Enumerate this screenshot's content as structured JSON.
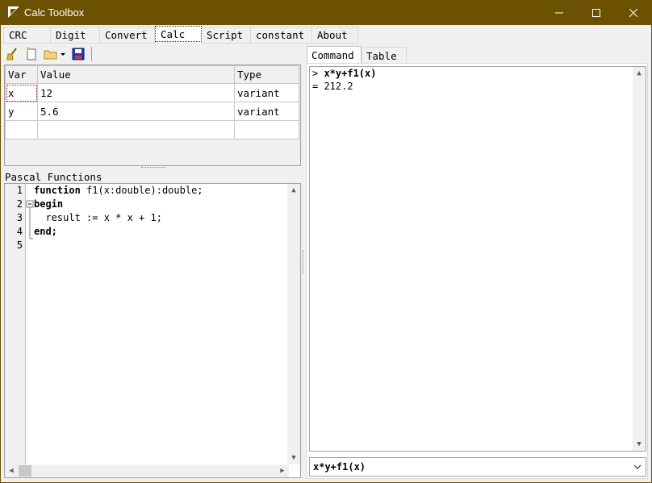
{
  "window": {
    "title": "Calc Toolbox"
  },
  "tabs": [
    "CRC",
    "Digit",
    "Convert",
    "Calc",
    "Script",
    "constant",
    "About"
  ],
  "active_tab": "Calc",
  "toolbar": {
    "icons": [
      "clear-icon",
      "new-file-icon",
      "open-folder-icon",
      "save-icon"
    ]
  },
  "variables": {
    "headers": {
      "var": "Var",
      "value": "Value",
      "type": "Type"
    },
    "rows": [
      {
        "var": "x",
        "value": "12",
        "type": "variant"
      },
      {
        "var": "y",
        "value": "5.6",
        "type": "variant"
      }
    ]
  },
  "pascal": {
    "label": "Pascal Functions",
    "line_numbers": [
      "1",
      "2",
      "3",
      "4",
      "5"
    ],
    "lines": {
      "l1_kw": "function",
      "l1_rest": " f1(x:double):double;",
      "l2": "begin",
      "l3": "  result := x * x + 1;",
      "l4": "end;",
      "l5": ""
    }
  },
  "right_tabs": [
    "Command",
    "Table"
  ],
  "console": {
    "prompt": "> ",
    "input": "x*y+f1(x)",
    "output": "= 212.2"
  },
  "command": {
    "value": "x*y+f1(x)"
  }
}
